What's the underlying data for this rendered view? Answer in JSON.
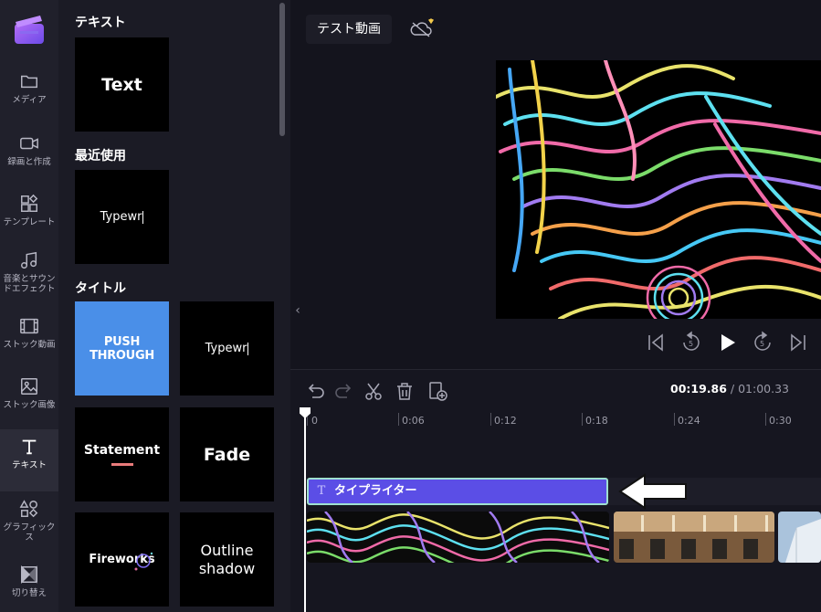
{
  "nav": {
    "items": [
      {
        "label": "メディア",
        "icon": "folder-icon"
      },
      {
        "label": "録画と作成",
        "icon": "video-camera-icon"
      },
      {
        "label": "テンプレート",
        "icon": "template-icon"
      },
      {
        "label": "音楽とサウンドエフェクト",
        "icon": "music-note-icon"
      },
      {
        "label": "ストック動画",
        "icon": "film-strip-icon"
      },
      {
        "label": "ストック画像",
        "icon": "image-icon"
      },
      {
        "label": "テキスト",
        "icon": "text-t-icon",
        "active": true
      },
      {
        "label": "グラフィックス",
        "icon": "shapes-icon"
      },
      {
        "label": "切り替え",
        "icon": "transition-icon"
      }
    ]
  },
  "panel": {
    "sections": {
      "text": "テキスト",
      "recent": "最近使用",
      "title": "タイトル"
    },
    "tiles": {
      "text": "Text",
      "recent_typewriter": "Typewr",
      "push_through": "PUSH THROUGH",
      "typewriter": "Typewr",
      "statement": "Statement",
      "fade": "Fade",
      "fireworks": "Fireworks",
      "outline_shadow": "Outline shadow"
    }
  },
  "topbar": {
    "project_name": "テスト動画"
  },
  "timeline": {
    "current_time": "00:19.86",
    "separator": " / ",
    "total_time": "01:00.33",
    "ruler": [
      "0",
      "0:06",
      "0:12",
      "0:18",
      "0:24",
      "0:30"
    ],
    "text_clip_label": "タイプライター"
  },
  "colors": {
    "accent": "#5b4ee6",
    "clip_border": "#9fe0d0",
    "push_through_bg": "#4a8fe8",
    "statement_underline": "#e97b7b"
  }
}
